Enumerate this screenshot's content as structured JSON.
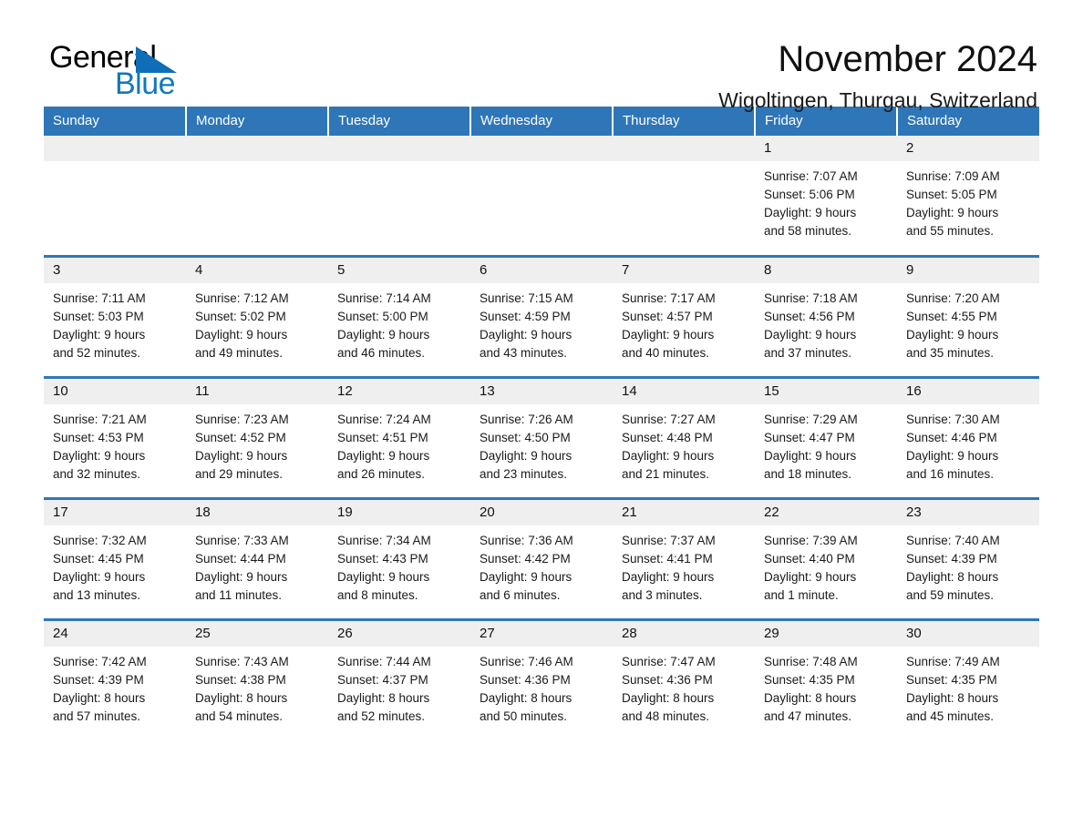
{
  "brand": {
    "name_part1": "General",
    "name_part2": "Blue",
    "triangle_icon": "blue-triangle-logo-mark",
    "accent_color": "#1477bd"
  },
  "header": {
    "title": "November 2024",
    "subtitle": "Wigoltingen, Thurgau, Switzerland"
  },
  "theme": {
    "header_blue": "#2e76b7",
    "day_band_gray": "#efefef",
    "text": "#1a1a1a"
  },
  "weekday_headers": [
    "Sunday",
    "Monday",
    "Tuesday",
    "Wednesday",
    "Thursday",
    "Friday",
    "Saturday"
  ],
  "weeks": [
    [
      {
        "day": "",
        "lines": []
      },
      {
        "day": "",
        "lines": []
      },
      {
        "day": "",
        "lines": []
      },
      {
        "day": "",
        "lines": []
      },
      {
        "day": "",
        "lines": []
      },
      {
        "day": "1",
        "lines": [
          "Sunrise: 7:07 AM",
          "Sunset: 5:06 PM",
          "Daylight: 9 hours",
          "and 58 minutes."
        ]
      },
      {
        "day": "2",
        "lines": [
          "Sunrise: 7:09 AM",
          "Sunset: 5:05 PM",
          "Daylight: 9 hours",
          "and 55 minutes."
        ]
      }
    ],
    [
      {
        "day": "3",
        "lines": [
          "Sunrise: 7:11 AM",
          "Sunset: 5:03 PM",
          "Daylight: 9 hours",
          "and 52 minutes."
        ]
      },
      {
        "day": "4",
        "lines": [
          "Sunrise: 7:12 AM",
          "Sunset: 5:02 PM",
          "Daylight: 9 hours",
          "and 49 minutes."
        ]
      },
      {
        "day": "5",
        "lines": [
          "Sunrise: 7:14 AM",
          "Sunset: 5:00 PM",
          "Daylight: 9 hours",
          "and 46 minutes."
        ]
      },
      {
        "day": "6",
        "lines": [
          "Sunrise: 7:15 AM",
          "Sunset: 4:59 PM",
          "Daylight: 9 hours",
          "and 43 minutes."
        ]
      },
      {
        "day": "7",
        "lines": [
          "Sunrise: 7:17 AM",
          "Sunset: 4:57 PM",
          "Daylight: 9 hours",
          "and 40 minutes."
        ]
      },
      {
        "day": "8",
        "lines": [
          "Sunrise: 7:18 AM",
          "Sunset: 4:56 PM",
          "Daylight: 9 hours",
          "and 37 minutes."
        ]
      },
      {
        "day": "9",
        "lines": [
          "Sunrise: 7:20 AM",
          "Sunset: 4:55 PM",
          "Daylight: 9 hours",
          "and 35 minutes."
        ]
      }
    ],
    [
      {
        "day": "10",
        "lines": [
          "Sunrise: 7:21 AM",
          "Sunset: 4:53 PM",
          "Daylight: 9 hours",
          "and 32 minutes."
        ]
      },
      {
        "day": "11",
        "lines": [
          "Sunrise: 7:23 AM",
          "Sunset: 4:52 PM",
          "Daylight: 9 hours",
          "and 29 minutes."
        ]
      },
      {
        "day": "12",
        "lines": [
          "Sunrise: 7:24 AM",
          "Sunset: 4:51 PM",
          "Daylight: 9 hours",
          "and 26 minutes."
        ]
      },
      {
        "day": "13",
        "lines": [
          "Sunrise: 7:26 AM",
          "Sunset: 4:50 PM",
          "Daylight: 9 hours",
          "and 23 minutes."
        ]
      },
      {
        "day": "14",
        "lines": [
          "Sunrise: 7:27 AM",
          "Sunset: 4:48 PM",
          "Daylight: 9 hours",
          "and 21 minutes."
        ]
      },
      {
        "day": "15",
        "lines": [
          "Sunrise: 7:29 AM",
          "Sunset: 4:47 PM",
          "Daylight: 9 hours",
          "and 18 minutes."
        ]
      },
      {
        "day": "16",
        "lines": [
          "Sunrise: 7:30 AM",
          "Sunset: 4:46 PM",
          "Daylight: 9 hours",
          "and 16 minutes."
        ]
      }
    ],
    [
      {
        "day": "17",
        "lines": [
          "Sunrise: 7:32 AM",
          "Sunset: 4:45 PM",
          "Daylight: 9 hours",
          "and 13 minutes."
        ]
      },
      {
        "day": "18",
        "lines": [
          "Sunrise: 7:33 AM",
          "Sunset: 4:44 PM",
          "Daylight: 9 hours",
          "and 11 minutes."
        ]
      },
      {
        "day": "19",
        "lines": [
          "Sunrise: 7:34 AM",
          "Sunset: 4:43 PM",
          "Daylight: 9 hours",
          "and 8 minutes."
        ]
      },
      {
        "day": "20",
        "lines": [
          "Sunrise: 7:36 AM",
          "Sunset: 4:42 PM",
          "Daylight: 9 hours",
          "and 6 minutes."
        ]
      },
      {
        "day": "21",
        "lines": [
          "Sunrise: 7:37 AM",
          "Sunset: 4:41 PM",
          "Daylight: 9 hours",
          "and 3 minutes."
        ]
      },
      {
        "day": "22",
        "lines": [
          "Sunrise: 7:39 AM",
          "Sunset: 4:40 PM",
          "Daylight: 9 hours",
          "and 1 minute."
        ]
      },
      {
        "day": "23",
        "lines": [
          "Sunrise: 7:40 AM",
          "Sunset: 4:39 PM",
          "Daylight: 8 hours",
          "and 59 minutes."
        ]
      }
    ],
    [
      {
        "day": "24",
        "lines": [
          "Sunrise: 7:42 AM",
          "Sunset: 4:39 PM",
          "Daylight: 8 hours",
          "and 57 minutes."
        ]
      },
      {
        "day": "25",
        "lines": [
          "Sunrise: 7:43 AM",
          "Sunset: 4:38 PM",
          "Daylight: 8 hours",
          "and 54 minutes."
        ]
      },
      {
        "day": "26",
        "lines": [
          "Sunrise: 7:44 AM",
          "Sunset: 4:37 PM",
          "Daylight: 8 hours",
          "and 52 minutes."
        ]
      },
      {
        "day": "27",
        "lines": [
          "Sunrise: 7:46 AM",
          "Sunset: 4:36 PM",
          "Daylight: 8 hours",
          "and 50 minutes."
        ]
      },
      {
        "day": "28",
        "lines": [
          "Sunrise: 7:47 AM",
          "Sunset: 4:36 PM",
          "Daylight: 8 hours",
          "and 48 minutes."
        ]
      },
      {
        "day": "29",
        "lines": [
          "Sunrise: 7:48 AM",
          "Sunset: 4:35 PM",
          "Daylight: 8 hours",
          "and 47 minutes."
        ]
      },
      {
        "day": "30",
        "lines": [
          "Sunrise: 7:49 AM",
          "Sunset: 4:35 PM",
          "Daylight: 8 hours",
          "and 45 minutes."
        ]
      }
    ]
  ]
}
